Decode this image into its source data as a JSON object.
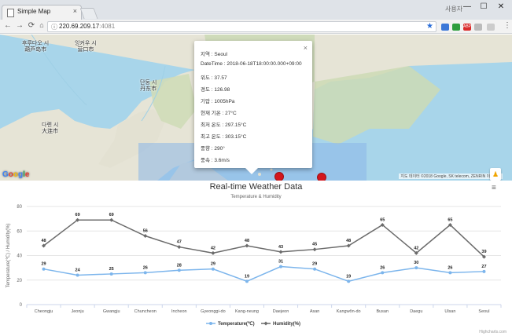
{
  "browser": {
    "tab_title": "Simple Map",
    "tab_close": "×",
    "user_icon_text": "사용자",
    "url_host": "220.69.209.17",
    "url_port": ":4081",
    "window_buttons": [
      "—",
      "☐",
      "✕"
    ],
    "nav_icons": [
      "←",
      "→",
      "⟳"
    ],
    "extension_badge": "ABP"
  },
  "map": {
    "labels": [
      {
        "id": "huludao",
        "text": "후루다오 시\n葫芦岛市"
      },
      {
        "id": "yingkou",
        "text": "잉커우 시\n营口市"
      },
      {
        "id": "dandong",
        "text": "단둥 시\n丹东市"
      },
      {
        "id": "dalian",
        "text": "다롄 시\n大连市"
      }
    ],
    "attribution": "지도 데이터 ©2018 Google, SK telecom, ZENRIN   이용약관",
    "google_logo": [
      "G",
      "o",
      "o",
      "g",
      "l",
      "e"
    ],
    "zoom_in": "+",
    "zoom_out": "−"
  },
  "infowindow": {
    "close": "×",
    "rows": [
      "지역 : Seoul",
      "DateTime : 2018-06-18T18:00:00.000+09:00",
      "위도 : 37.57",
      "경도 : 126.98",
      "기압 : 1005hPa",
      "현재 기온 : 27°C",
      "최저 온도 : 297.15°C",
      "최고 온도 : 303.15°C",
      "풍향 : 290°",
      "풍속 : 3.6m/s"
    ]
  },
  "chart": {
    "title": "Real-time Weather Data",
    "subtitle": "Temperature & Humidity",
    "credits": "Highcharts.com",
    "menu_icon": "≡"
  },
  "chart_data": {
    "type": "line",
    "title": "Real-time Weather Data",
    "subtitle": "Temperature & Humidity",
    "ylabel": "Temperature(℃) / Humidity(%)",
    "xlabel": "",
    "ylim": [
      0,
      80
    ],
    "yticks": [
      0,
      20,
      40,
      60,
      80
    ],
    "grid": true,
    "legend_position": "bottom-center",
    "categories": [
      "Cheongju",
      "Jeonju",
      "Gwangju",
      "Chuncheon",
      "Incheon",
      "Gyeonggi-do",
      "Kang-neung",
      "Daejeon",
      "Asan",
      "Kangwŏn-do",
      "Busan",
      "Daegu",
      "Ulsan",
      "Seoul"
    ],
    "series": [
      {
        "name": "Temperature(℃)",
        "color": "#7cb5ec",
        "marker": "circle",
        "values": [
          29,
          24,
          25,
          26,
          28,
          29,
          19,
          31,
          29,
          19,
          26,
          30,
          26,
          27
        ]
      },
      {
        "name": "Humidity(%)",
        "color": "#6b6b6b",
        "marker": "diamond",
        "values": [
          48,
          69,
          69,
          56,
          47,
          42,
          48,
          43,
          45,
          48,
          65,
          42,
          65,
          39
        ]
      }
    ]
  }
}
